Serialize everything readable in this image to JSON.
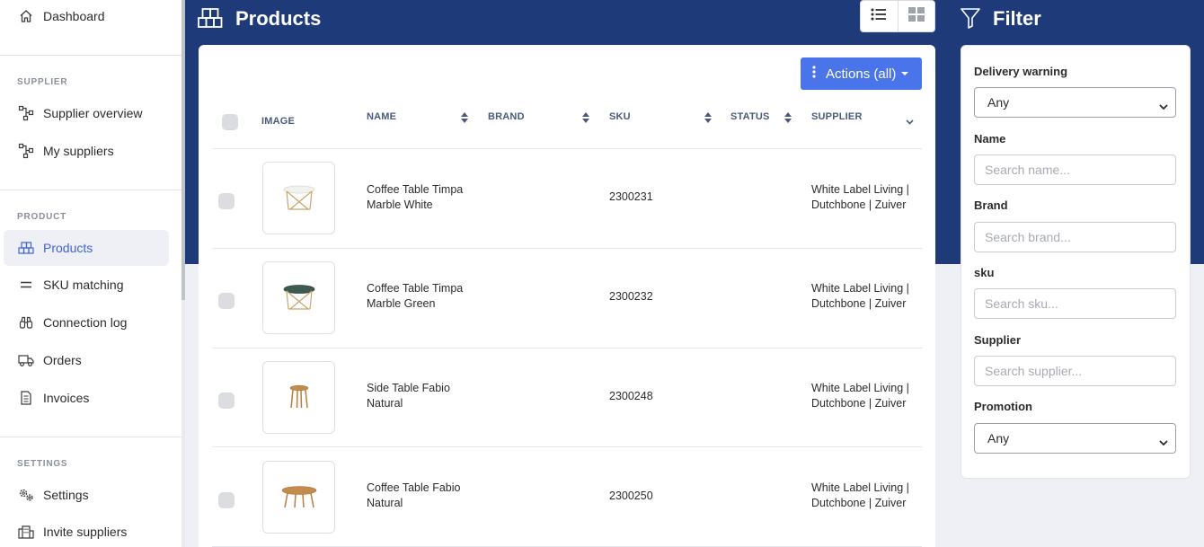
{
  "sidebar": {
    "top_item": "Dashboard",
    "sections": [
      {
        "label": "SUPPLIER",
        "items": [
          "Supplier overview",
          "My suppliers"
        ]
      },
      {
        "label": "PRODUCT",
        "items": [
          "Products",
          "SKU matching",
          "Connection log",
          "Orders",
          "Invoices"
        ]
      },
      {
        "label": "SETTINGS",
        "items": [
          "Settings",
          "Invite suppliers"
        ]
      }
    ],
    "active_item": "Products"
  },
  "header": {
    "title": "Products",
    "filter_title": "Filter"
  },
  "table": {
    "actions_label": "Actions (all)",
    "columns": [
      "IMAGE",
      "NAME",
      "BRAND",
      "SKU",
      "STATUS",
      "SUPPLIER"
    ],
    "rows": [
      {
        "name_line1": "Coffee Table Timpa",
        "name_line2": "Marble White",
        "brand": "",
        "sku": "2300231",
        "status": "",
        "supplier_line1": "White Label Living |",
        "supplier_line2": "Dutchbone | Zuiver"
      },
      {
        "name_line1": "Coffee Table Timpa",
        "name_line2": "Marble Green",
        "brand": "",
        "sku": "2300232",
        "status": "",
        "supplier_line1": "White Label Living |",
        "supplier_line2": "Dutchbone | Zuiver"
      },
      {
        "name_line1": "Side Table Fabio",
        "name_line2": "Natural",
        "brand": "",
        "sku": "2300248",
        "status": "",
        "supplier_line1": "White Label Living |",
        "supplier_line2": "Dutchbone | Zuiver"
      },
      {
        "name_line1": "Coffee Table Fabio",
        "name_line2": "Natural",
        "brand": "",
        "sku": "2300250",
        "status": "",
        "supplier_line1": "White Label Living |",
        "supplier_line2": "Dutchbone | Zuiver"
      }
    ]
  },
  "filter": {
    "delivery_warning": {
      "label": "Delivery warning",
      "value": "Any"
    },
    "name": {
      "label": "Name",
      "placeholder": "Search name..."
    },
    "brand": {
      "label": "Brand",
      "placeholder": "Search brand..."
    },
    "sku": {
      "label": "sku",
      "placeholder": "Search sku..."
    },
    "supplier": {
      "label": "Supplier",
      "placeholder": "Search supplier..."
    },
    "promotion": {
      "label": "Promotion",
      "value": "Any"
    }
  },
  "colors": {
    "header_band": "#1e3a78",
    "accent": "#4a74ea",
    "active_nav_text": "#3f63d4"
  }
}
